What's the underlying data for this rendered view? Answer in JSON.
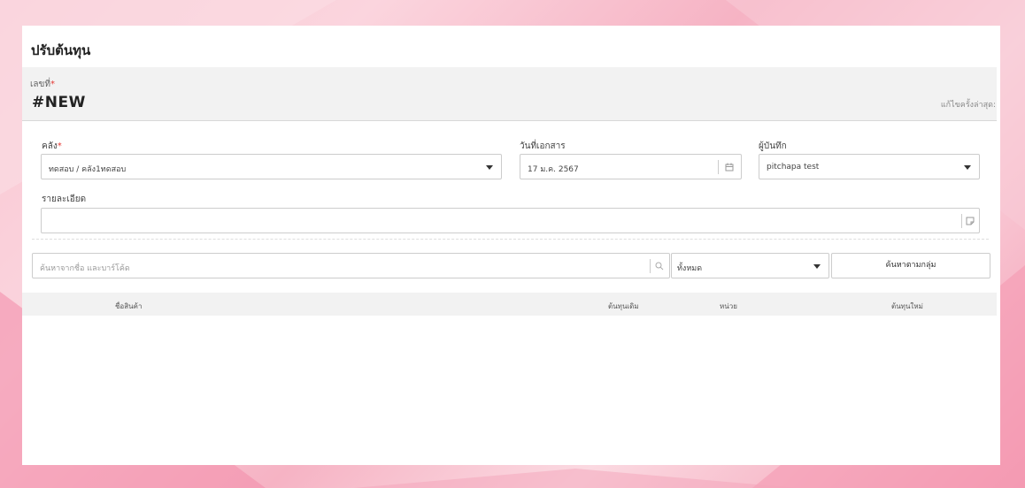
{
  "page": {
    "title": "ปรับต้นทุน"
  },
  "document": {
    "number_label": "เลขที่",
    "required_mark": "*",
    "number_value": "#NEW",
    "last_edited_label": "แก้ไขครั้งล่าสุด:"
  },
  "form": {
    "warehouse": {
      "label": "คลัง",
      "value": "ทดสอบ / คลัง1ทดสอบ"
    },
    "doc_date": {
      "label": "วันที่เอกสาร",
      "value": "17 ม.ค. 2567"
    },
    "recorder": {
      "label": "ผู้บันทึก",
      "value": "pitchapa test"
    },
    "details": {
      "label": "รายละเอียด",
      "value": ""
    }
  },
  "search": {
    "placeholder": "ค้นหาจากชื่อ และบาร์โค้ด",
    "group_filter_value": "ทั้งหมด",
    "group_search_button": "ค้นหาตามกลุ่ม"
  },
  "table": {
    "columns": [
      "ชื่อสินค้า",
      "ต้นทุนเดิม",
      "หน่วย",
      "ต้นทุนใหม่"
    ],
    "rows": []
  },
  "icons": {
    "calendar": "calendar-icon",
    "note": "note-icon",
    "search": "search-icon",
    "dropdown": "chevron-down-icon"
  },
  "colors": {
    "required": "#e53935",
    "background_pink": "#f6b3c4"
  }
}
